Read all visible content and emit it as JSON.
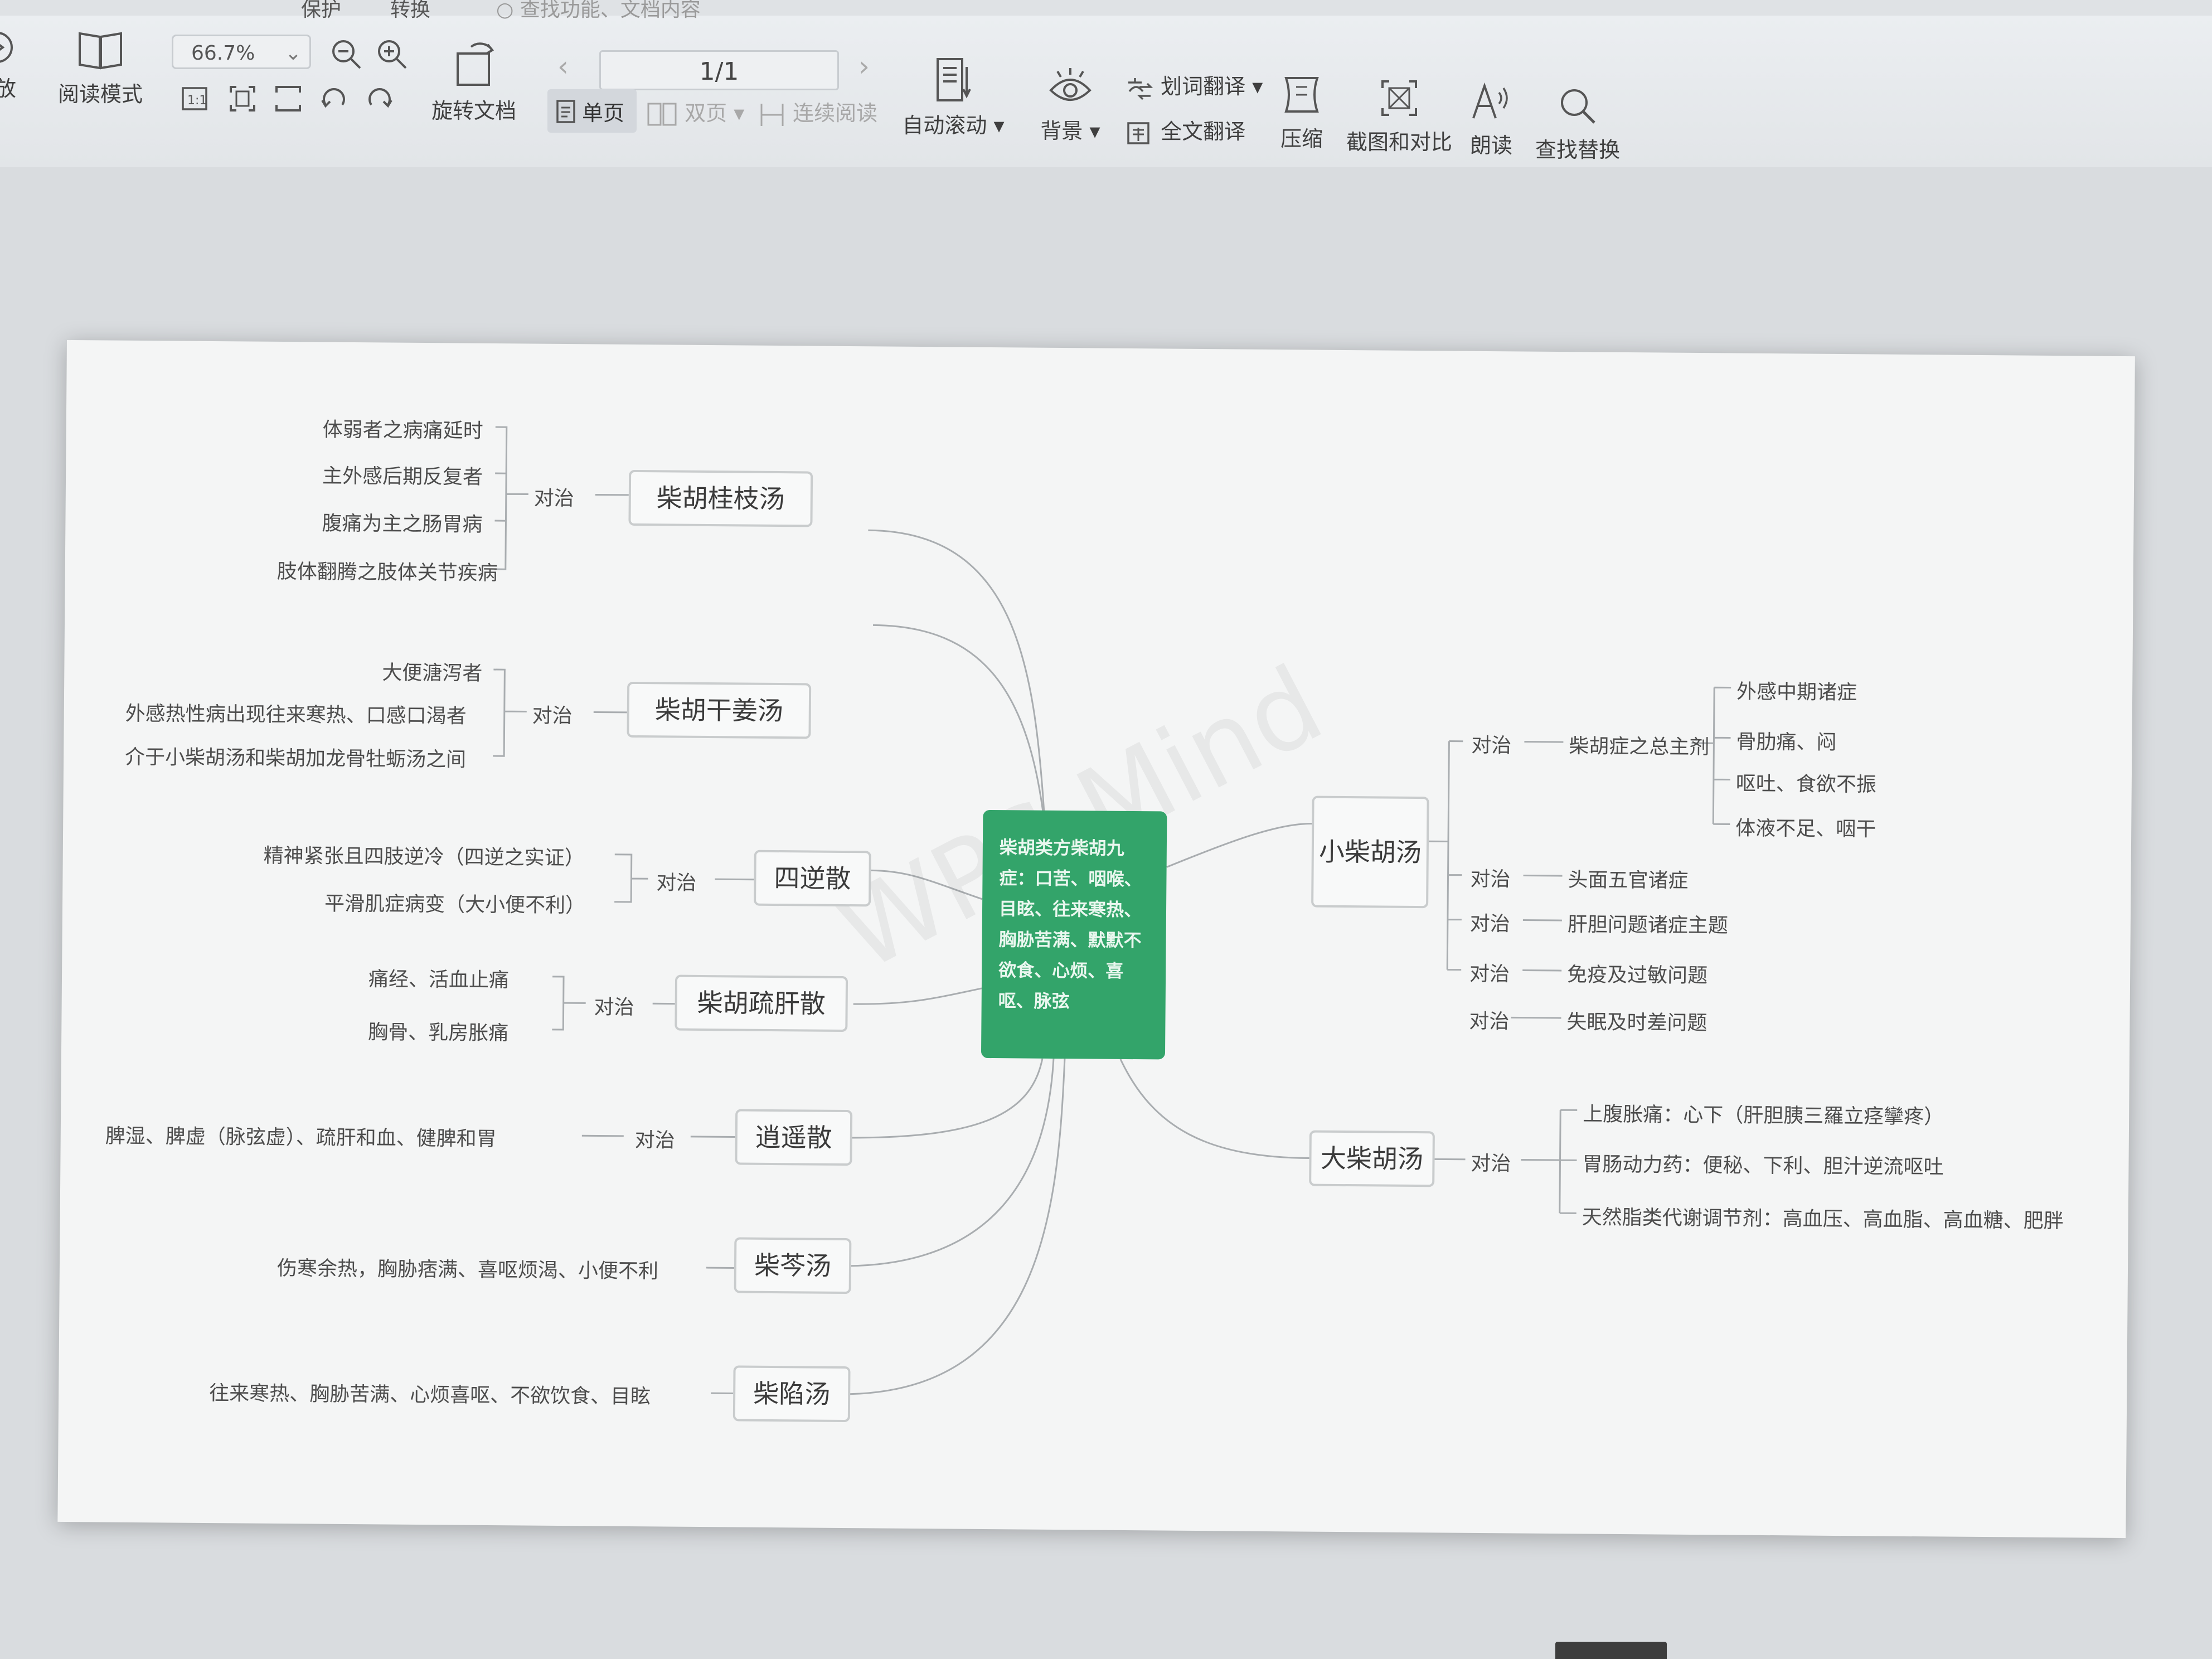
{
  "toolbar": {
    "top_tabs": [
      "保护",
      "转换"
    ],
    "search_placeholder": "查找功能、文档内容",
    "play_label": "放",
    "reading_mode": "阅读模式",
    "zoom_value": "66.7%",
    "rotate_label": "旋转文档",
    "single_page": "单页",
    "double_page": "双页",
    "continuous": "连续阅读",
    "page_indicator": "1/1",
    "auto_scroll": "自动滚动",
    "background": "背景",
    "word_translate": "划词翻译",
    "full_translate": "全文翻译",
    "compress": "压缩",
    "screenshot_compare": "截图和对比",
    "read_aloud": "朗读",
    "find_replace": "查找替换"
  },
  "colors": {
    "center_node": "#33a46a",
    "toolbar_bg": "#e6e9ec",
    "page_bg": "#f4f5f5"
  },
  "mindmap": {
    "center": "柴胡类方柴胡九症：口苦、咽喉、目眩、往来寒热、胸胁苦满、默默不欲食、心烦、喜呕、脉弦",
    "relation": "对治",
    "left": [
      {
        "name": "柴胡桂枝汤",
        "items": [
          "体弱者之病痛延时",
          "主外感后期反复者",
          "腹痛为主之肠胃病",
          "肢体翻腾之肢体关节疾病"
        ]
      },
      {
        "name": "柴胡干姜汤",
        "items": [
          "大便溏泻者",
          "外感热性病出现往来寒热、口感口渴者",
          "介于小柴胡汤和柴胡加龙骨牡蛎汤之间"
        ]
      },
      {
        "name": "四逆散",
        "items": [
          "精神紧张且四肢逆冷（四逆之实证）",
          "平滑肌症病变（大小便不利）"
        ]
      },
      {
        "name": "柴胡疏肝散",
        "items": [
          "痛经、活血止痛",
          "胸骨、乳房胀痛"
        ]
      },
      {
        "name": "逍遥散",
        "items": [
          "脾湿、脾虚（脉弦虚）、疏肝和血、健脾和胃"
        ]
      },
      {
        "name": "柴芩汤",
        "items": [
          "伤寒余热，胸胁痞满、喜呕烦渴、小便不利"
        ]
      },
      {
        "name": "柴陷汤",
        "items": [
          "往来寒热、胸胁苦满、心烦喜呕、不欲饮食、目眩"
        ]
      }
    ],
    "xiaochaihu": {
      "name": "小柴胡汤",
      "main": "柴胡症之总主剂",
      "sub": [
        "外感中期诸症",
        "骨肋痛、闷",
        "呕吐、食欲不振",
        "体液不足、咽干"
      ],
      "others": [
        "头面五官诸症",
        "肝胆问题诸症主题",
        "免疫及过敏问题",
        "失眠及时差问题"
      ]
    },
    "dachaihu": {
      "name": "大柴胡汤",
      "items": [
        "上腹胀痛：心下（肝胆胰三羅立痉攣疼）",
        "胃肠动力药：便秘、下利、胆汁逆流呕吐",
        "天然脂类代谢调节剂：高血压、高血脂、高血糖、肥胖"
      ]
    }
  }
}
